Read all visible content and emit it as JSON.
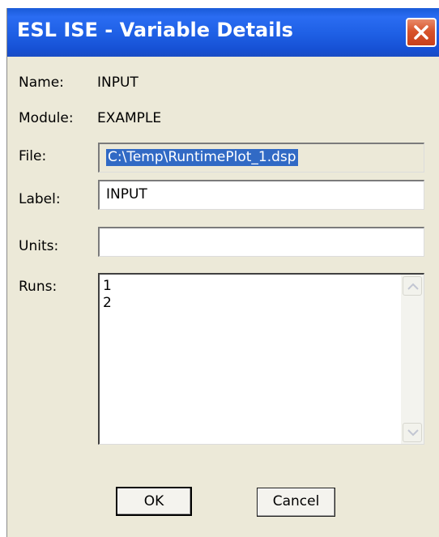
{
  "window": {
    "title": "ESL ISE - Variable Details",
    "close_icon": "close-icon"
  },
  "info": {
    "name_label": "Name:",
    "name_value": "INPUT",
    "module_label": "Module:",
    "module_value": "EXAMPLE"
  },
  "fields": {
    "file_label": "File:",
    "file_value": "C:\\Temp\\RuntimePlot_1.dsp",
    "label_label": "Label:",
    "label_value": "INPUT",
    "units_label": "Units:",
    "units_value": ""
  },
  "runs": {
    "label": "Runs:",
    "items": [
      "1",
      "2"
    ]
  },
  "buttons": {
    "ok": "OK",
    "cancel": "Cancel"
  },
  "colors": {
    "titlebar": "#1e5fe4",
    "dialog_bg": "#ece9d8",
    "selection": "#316ac5",
    "close_button": "#d8542c"
  }
}
